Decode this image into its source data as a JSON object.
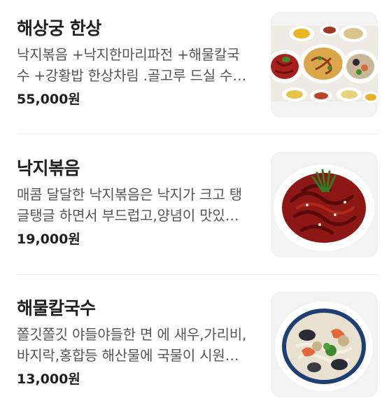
{
  "menu": {
    "items": [
      {
        "name": "해상궁 한상",
        "description": "낙지볶음 +낙지한마리파전 +해물칼국수 +강황밥 한상차림 .골고루 드실 수 있는 구성입니다",
        "price": "55,000원",
        "image_icon": "seafood-set-platter-image"
      },
      {
        "name": "낙지볶음",
        "description": "매콤 달달한 낙지볶음은 낙지가 크고 탱글탱글 하면서 부드럽고,양념이 맛있습니다",
        "price": "19,000원",
        "image_icon": "stir-fried-octopus-image"
      },
      {
        "name": "해물칼국수",
        "description": "쫄깃쫄깃 야들야들한 면 에 새우,가리비,바지락,홍합등 해산물에 국물이 시원합니다",
        "price": "13,000원",
        "image_icon": "seafood-noodle-soup-image"
      }
    ]
  }
}
